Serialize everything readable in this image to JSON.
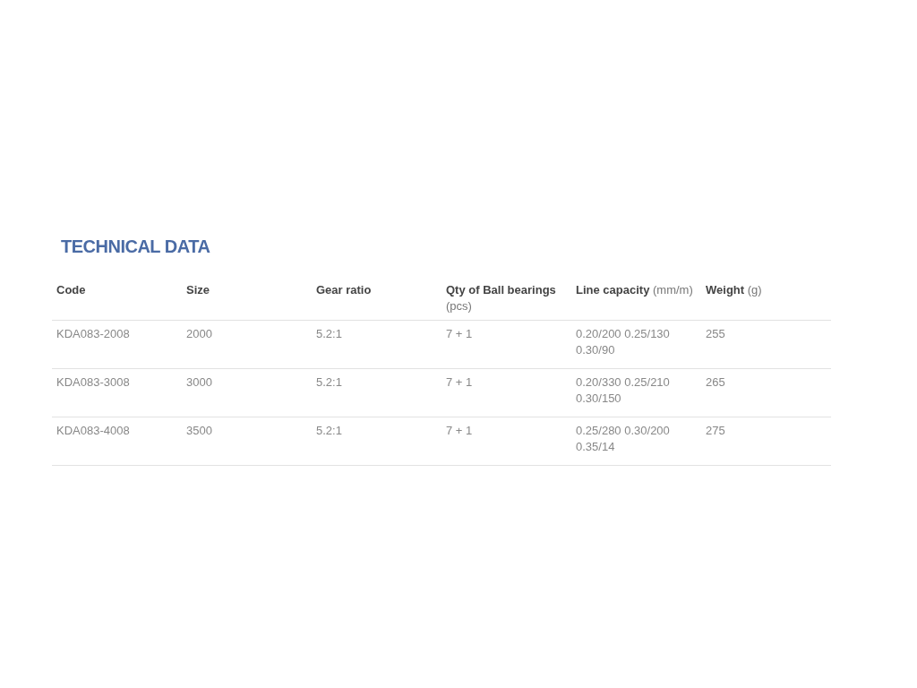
{
  "title": "TECHNICAL DATA",
  "table": {
    "columns": [
      "**Code**",
      "**Size**",
      "**Gear ratio**",
      "**Qty of Ball bearings** (pcs)",
      "**Line capacity** (mm/m)",
      "**Weight** (g)"
    ],
    "rows": [
      [
        "KDA083-2008",
        "2000",
        "5.2:1",
        "7 + 1",
        "0.20/200 0.25/130 0.30/90",
        "255"
      ],
      [
        "KDA083-3008",
        "3000",
        "5.2:1",
        "7 + 1",
        "0.20/330 0.25/210 0.30/150",
        "265"
      ],
      [
        "KDA083-4008",
        "3500",
        "5.2:1",
        "7 + 1",
        "0.25/280 0.30/200 0.35/14",
        "275"
      ]
    ]
  }
}
